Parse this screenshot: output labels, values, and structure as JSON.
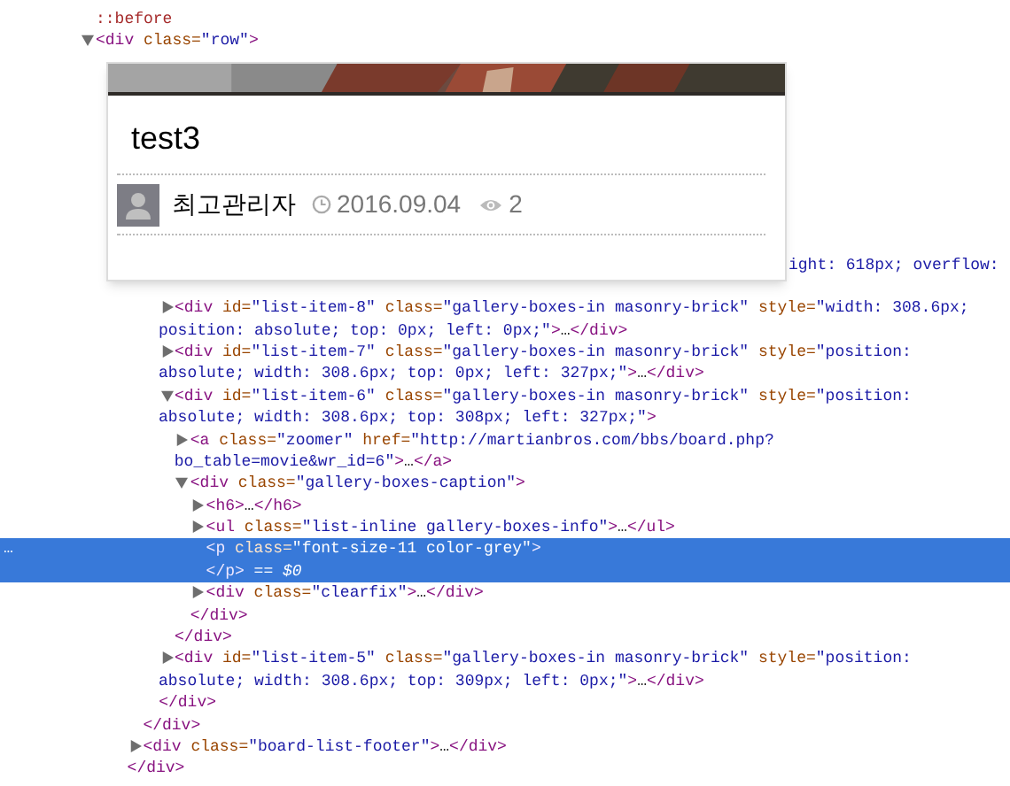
{
  "tree": [
    {
      "selected": false,
      "lines": [
        [
          {
            "kind": "pseudo",
            "text": "::before"
          }
        ]
      ]
    },
    {
      "selected": false,
      "expanded": true,
      "lines": [
        [
          {
            "kind": "tag",
            "text": "<div"
          },
          {
            "kind": "attr",
            "text": " class="
          },
          {
            "kind": "val",
            "text": "\"row\""
          },
          {
            "kind": "tag",
            "text": ">"
          }
        ]
      ],
      "children": [
        {
          "children": [
            {
              "selected": false,
              "children": [
                {
                  "selected": false,
                  "children": [
                    {
                      "selected": false,
                      "clipped": true,
                      "lines": [
                        [
                          {
                            "kind": "val",
                            "text": "ight: 618px; overflow:"
                          }
                        ]
                      ],
                      "children": [
                        {
                          "selected": false,
                          "expanded": false,
                          "lines": [
                            [
                              {
                                "kind": "tag",
                                "text": "<div"
                              },
                              {
                                "kind": "attr",
                                "text": " id="
                              },
                              {
                                "kind": "val",
                                "text": "\"list-item-8\""
                              },
                              {
                                "kind": "attr",
                                "text": " class="
                              },
                              {
                                "kind": "val",
                                "text": "\"gallery-boxes-in masonry-brick\""
                              },
                              {
                                "kind": "attr",
                                "text": " style="
                              },
                              {
                                "kind": "val",
                                "text": "\"width: 308.6px;"
                              }
                            ],
                            [
                              {
                                "kind": "val",
                                "text": "position: absolute; top: 0px; left: 0px;\""
                              },
                              {
                                "kind": "tag",
                                "text": ">"
                              },
                              {
                                "kind": "text",
                                "text": "…"
                              },
                              {
                                "kind": "tag",
                                "text": "</div>"
                              }
                            ]
                          ]
                        },
                        {
                          "selected": false,
                          "expanded": false,
                          "lines": [
                            [
                              {
                                "kind": "tag",
                                "text": "<div"
                              },
                              {
                                "kind": "attr",
                                "text": " id="
                              },
                              {
                                "kind": "val",
                                "text": "\"list-item-7\""
                              },
                              {
                                "kind": "attr",
                                "text": " class="
                              },
                              {
                                "kind": "val",
                                "text": "\"gallery-boxes-in masonry-brick\""
                              },
                              {
                                "kind": "attr",
                                "text": " style="
                              },
                              {
                                "kind": "val",
                                "text": "\"position:"
                              }
                            ],
                            [
                              {
                                "kind": "val",
                                "text": "absolute; width: 308.6px; top: 0px; left: 327px;\""
                              },
                              {
                                "kind": "tag",
                                "text": ">"
                              },
                              {
                                "kind": "text",
                                "text": "…"
                              },
                              {
                                "kind": "tag",
                                "text": "</div>"
                              }
                            ]
                          ]
                        },
                        {
                          "selected": false,
                          "expanded": true,
                          "lines": [
                            [
                              {
                                "kind": "tag",
                                "text": "<div"
                              },
                              {
                                "kind": "attr",
                                "text": " id="
                              },
                              {
                                "kind": "val",
                                "text": "\"list-item-6\""
                              },
                              {
                                "kind": "attr",
                                "text": " class="
                              },
                              {
                                "kind": "val",
                                "text": "\"gallery-boxes-in masonry-brick\""
                              },
                              {
                                "kind": "attr",
                                "text": " style="
                              },
                              {
                                "kind": "val",
                                "text": "\"position:"
                              }
                            ],
                            [
                              {
                                "kind": "val",
                                "text": "absolute; width: 308.6px; top: 308px; left: 327px;\""
                              },
                              {
                                "kind": "tag",
                                "text": ">"
                              }
                            ]
                          ],
                          "children": [
                            {
                              "selected": false,
                              "expanded": false,
                              "lines": [
                                [
                                  {
                                    "kind": "tag",
                                    "text": "<a"
                                  },
                                  {
                                    "kind": "attr",
                                    "text": " class="
                                  },
                                  {
                                    "kind": "val",
                                    "text": "\"zoomer\""
                                  },
                                  {
                                    "kind": "attr",
                                    "text": " href="
                                  },
                                  {
                                    "kind": "val",
                                    "text": "\"http://martianbros.com/bbs/board.php?"
                                  }
                                ],
                                [
                                  {
                                    "kind": "val",
                                    "text": "bo_table=movie&wr_id=6\""
                                  },
                                  {
                                    "kind": "tag",
                                    "text": ">"
                                  },
                                  {
                                    "kind": "text",
                                    "text": "…"
                                  },
                                  {
                                    "kind": "tag",
                                    "text": "</a>"
                                  }
                                ]
                              ]
                            },
                            {
                              "selected": false,
                              "expanded": true,
                              "lines": [
                                [
                                  {
                                    "kind": "tag",
                                    "text": "<div"
                                  },
                                  {
                                    "kind": "attr",
                                    "text": " class="
                                  },
                                  {
                                    "kind": "val",
                                    "text": "\"gallery-boxes-caption\""
                                  },
                                  {
                                    "kind": "tag",
                                    "text": ">"
                                  }
                                ]
                              ],
                              "children": [
                                {
                                  "selected": false,
                                  "expanded": false,
                                  "lines": [
                                    [
                                      {
                                        "kind": "tag",
                                        "text": "<h6>"
                                      },
                                      {
                                        "kind": "text",
                                        "text": "…"
                                      },
                                      {
                                        "kind": "tag",
                                        "text": "</h6>"
                                      }
                                    ]
                                  ]
                                },
                                {
                                  "selected": false,
                                  "expanded": false,
                                  "lines": [
                                    [
                                      {
                                        "kind": "tag",
                                        "text": "<ul"
                                      },
                                      {
                                        "kind": "attr",
                                        "text": " class="
                                      },
                                      {
                                        "kind": "val",
                                        "text": "\"list-inline gallery-boxes-info\""
                                      },
                                      {
                                        "kind": "tag",
                                        "text": ">"
                                      },
                                      {
                                        "kind": "text",
                                        "text": "…"
                                      },
                                      {
                                        "kind": "tag",
                                        "text": "</ul>"
                                      }
                                    ]
                                  ]
                                },
                                {
                                  "selected": true,
                                  "gutter": "…",
                                  "lines": [
                                    [
                                      {
                                        "kind": "tag",
                                        "text": "<p"
                                      },
                                      {
                                        "kind": "attr",
                                        "text": " class="
                                      },
                                      {
                                        "kind": "val",
                                        "text": "\"font-size-11 color-grey\""
                                      },
                                      {
                                        "kind": "tag",
                                        "text": ">"
                                      }
                                    ]
                                  ],
                                  "close": [
                                    {
                                      "kind": "tag",
                                      "text": "</p>"
                                    },
                                    {
                                      "kind": "hint",
                                      "text": " == $0"
                                    }
                                  ]
                                },
                                {
                                  "selected": false,
                                  "expanded": false,
                                  "lines": [
                                    [
                                      {
                                        "kind": "tag",
                                        "text": "<div"
                                      },
                                      {
                                        "kind": "attr",
                                        "text": " class="
                                      },
                                      {
                                        "kind": "val",
                                        "text": "\"clearfix\""
                                      },
                                      {
                                        "kind": "tag",
                                        "text": ">"
                                      },
                                      {
                                        "kind": "text",
                                        "text": "…"
                                      },
                                      {
                                        "kind": "tag",
                                        "text": "</div>"
                                      }
                                    ]
                                  ]
                                }
                              ],
                              "close": [
                                {
                                  "kind": "tag",
                                  "text": "</div>"
                                }
                              ]
                            }
                          ],
                          "close": [
                            {
                              "kind": "tag",
                              "text": "</div>"
                            }
                          ]
                        },
                        {
                          "selected": false,
                          "expanded": false,
                          "lines": [
                            [
                              {
                                "kind": "tag",
                                "text": "<div"
                              },
                              {
                                "kind": "attr",
                                "text": " id="
                              },
                              {
                                "kind": "val",
                                "text": "\"list-item-5\""
                              },
                              {
                                "kind": "attr",
                                "text": " class="
                              },
                              {
                                "kind": "val",
                                "text": "\"gallery-boxes-in masonry-brick\""
                              },
                              {
                                "kind": "attr",
                                "text": " style="
                              },
                              {
                                "kind": "val",
                                "text": "\"position:"
                              }
                            ],
                            [
                              {
                                "kind": "val",
                                "text": "absolute; width: 308.6px; top: 309px; left: 0px;\""
                              },
                              {
                                "kind": "tag",
                                "text": ">"
                              },
                              {
                                "kind": "text",
                                "text": "…"
                              },
                              {
                                "kind": "tag",
                                "text": "</div>"
                              }
                            ]
                          ]
                        }
                      ],
                      "close": [
                        {
                          "kind": "tag",
                          "text": "</div>"
                        }
                      ]
                    }
                  ],
                  "close": [
                    {
                      "kind": "tag",
                      "text": "</div>"
                    }
                  ]
                },
                {
                  "selected": false,
                  "expanded": false,
                  "lines": [
                    [
                      {
                        "kind": "tag",
                        "text": "<div"
                      },
                      {
                        "kind": "attr",
                        "text": " class="
                      },
                      {
                        "kind": "val",
                        "text": "\"board-list-footer\""
                      },
                      {
                        "kind": "tag",
                        "text": ">"
                      },
                      {
                        "kind": "text",
                        "text": "…"
                      },
                      {
                        "kind": "tag",
                        "text": "</div>"
                      }
                    ]
                  ]
                }
              ],
              "close": [
                {
                  "kind": "tag",
                  "text": "</div>"
                }
              ]
            }
          ]
        }
      ]
    }
  ],
  "preview_card": {
    "title": "test3",
    "author": "최고관리자",
    "date": "2016.09.04",
    "views": "2"
  }
}
